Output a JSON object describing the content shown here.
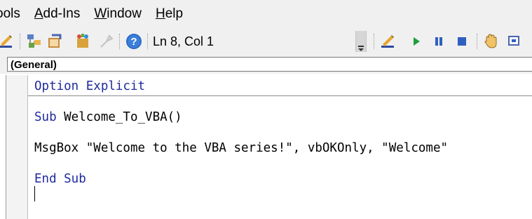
{
  "menubar": {
    "items": [
      {
        "label": "ools",
        "accel": "",
        "rest": "ools"
      },
      {
        "label": "Add-Ins",
        "accel": "A",
        "rest": "dd-Ins"
      },
      {
        "label": "Window",
        "accel": "W",
        "rest": "indow"
      },
      {
        "label": "Help",
        "accel": "H",
        "rest": "elp"
      }
    ]
  },
  "toolbar": {
    "status": "Ln 8, Col 1",
    "icons": [
      "design-mode-icon",
      "project-explorer-icon",
      "properties-window-icon",
      "object-browser-icon",
      "toolbox-icon",
      "help-icon",
      "design-mode-icon",
      "run-icon",
      "break-icon",
      "reset-icon",
      "toggle-breakpoint-icon",
      "step-icon"
    ]
  },
  "object_bar": {
    "selected": "(General)"
  },
  "code": {
    "line1_kw": "Option Explicit",
    "line2_kw": "Sub",
    "line2_rest": " Welcome_To_VBA()",
    "line3": "MsgBox \"Welcome to the VBA series!\", vbOKOnly, \"Welcome\"",
    "line4_kw": "End Sub"
  },
  "colors": {
    "keyword": "#1f2a9c",
    "toolbar_bg": "#f0f0f0"
  }
}
